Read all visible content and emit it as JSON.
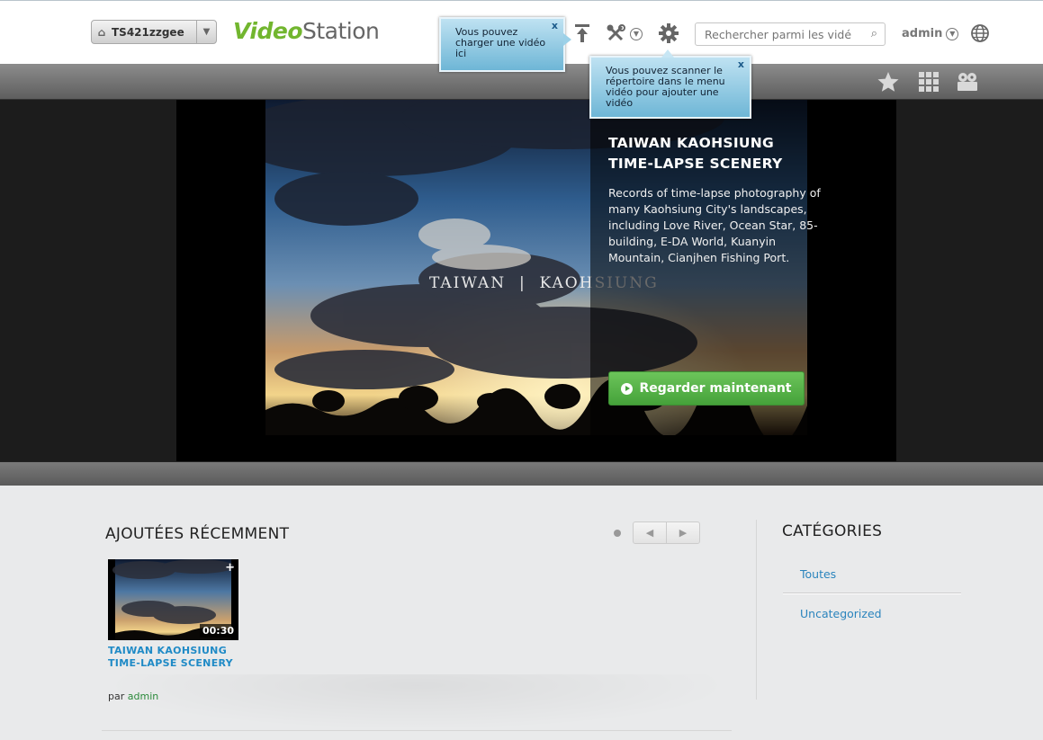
{
  "header": {
    "nas_name": "TS421zzgee",
    "logo_part1": "Video",
    "logo_part2": "Station",
    "search_placeholder": "Rechercher parmi les vidé",
    "user": "admin"
  },
  "tooltips": {
    "upload": "Vous pouvez charger une vidéo ici",
    "scan": "Vous pouvez scanner le répertoire dans le menu vidéo pour ajouter une vidéo",
    "close": "x"
  },
  "hero": {
    "title": "TAIWAN KAOHSIUNG TIME-LAPSE SCENERY",
    "description": "Records of time-lapse photography of many Kaohsiung City's landscapes, including Love River, Ocean Star, 85-building, E-DA World, Kuanyin Mountain, Cianjhen Fishing Port.",
    "watermark": "TAIWAN  |  KAOHSIUNG",
    "watch_label": "Regarder maintenant"
  },
  "recent": {
    "title": "AJOUTÉES RÉCEMMENT",
    "videos": [
      {
        "title": "TAIWAN KAOHSIUNG TIME-LAPSE SCENERY",
        "duration": "00:30",
        "by_prefix": "par",
        "owner": "admin"
      }
    ]
  },
  "categories": {
    "title": "CATÉGORIES",
    "items": [
      "Toutes",
      "Uncategorized"
    ]
  },
  "colors": {
    "brand_green": "#72b62f",
    "button_green": "#45a23a",
    "link_blue": "#1f8ac6",
    "tooltip_blue": "#6eb6d6"
  }
}
